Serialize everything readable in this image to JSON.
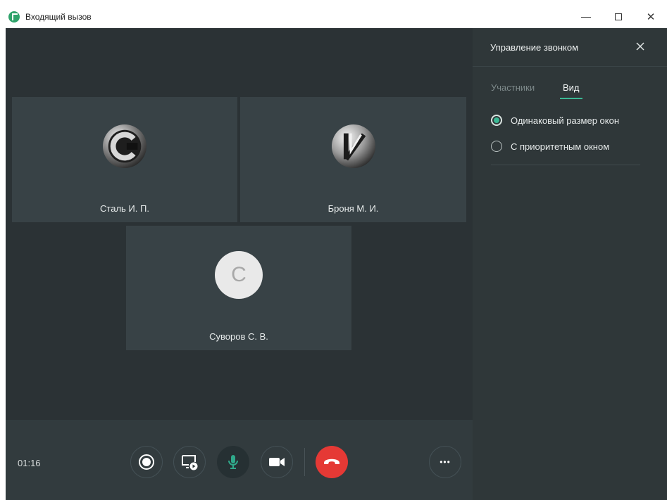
{
  "window": {
    "title": "Входящий вызов",
    "close_glyph": "✕"
  },
  "participants": [
    {
      "name": "Сталь И. П.",
      "avatar": "c-logo-avatar"
    },
    {
      "name": "Броня М. И.",
      "avatar": "v-logo-avatar"
    },
    {
      "name": "Суворов С. В.",
      "avatar_letter": "С"
    }
  ],
  "controls": {
    "timer": "01:16",
    "buttons": [
      "record-icon",
      "share-screen-icon",
      "microphone-icon",
      "camera-icon",
      "hangup-icon",
      "more-icon"
    ],
    "more_glyph": "•••"
  },
  "panel": {
    "title": "Управление звонком",
    "tabs": [
      {
        "label": "Участники",
        "active": false
      },
      {
        "label": "Вид",
        "active": true
      }
    ],
    "layout_options": [
      {
        "label": "Одинаковый размер окон",
        "checked": true
      },
      {
        "label": "С приоритетным окном",
        "checked": false
      }
    ]
  },
  "colors": {
    "accent": "#3bb894",
    "hangup": "#e53935",
    "mic_active": "#2fa88a",
    "stage_bg": "#2b3235",
    "tile_bg": "#384246"
  }
}
